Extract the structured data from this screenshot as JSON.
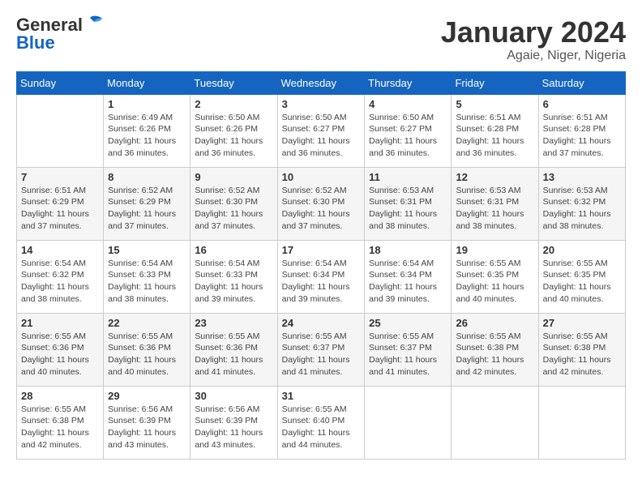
{
  "header": {
    "logo_general": "General",
    "logo_blue": "Blue",
    "month": "January 2024",
    "location": "Agaie, Niger, Nigeria"
  },
  "days_of_week": [
    "Sunday",
    "Monday",
    "Tuesday",
    "Wednesday",
    "Thursday",
    "Friday",
    "Saturday"
  ],
  "weeks": [
    [
      {
        "day": "",
        "sunrise": "",
        "sunset": "",
        "daylight": ""
      },
      {
        "day": "1",
        "sunrise": "Sunrise: 6:49 AM",
        "sunset": "Sunset: 6:26 PM",
        "daylight": "Daylight: 11 hours and 36 minutes."
      },
      {
        "day": "2",
        "sunrise": "Sunrise: 6:50 AM",
        "sunset": "Sunset: 6:26 PM",
        "daylight": "Daylight: 11 hours and 36 minutes."
      },
      {
        "day": "3",
        "sunrise": "Sunrise: 6:50 AM",
        "sunset": "Sunset: 6:27 PM",
        "daylight": "Daylight: 11 hours and 36 minutes."
      },
      {
        "day": "4",
        "sunrise": "Sunrise: 6:50 AM",
        "sunset": "Sunset: 6:27 PM",
        "daylight": "Daylight: 11 hours and 36 minutes."
      },
      {
        "day": "5",
        "sunrise": "Sunrise: 6:51 AM",
        "sunset": "Sunset: 6:28 PM",
        "daylight": "Daylight: 11 hours and 36 minutes."
      },
      {
        "day": "6",
        "sunrise": "Sunrise: 6:51 AM",
        "sunset": "Sunset: 6:28 PM",
        "daylight": "Daylight: 11 hours and 37 minutes."
      }
    ],
    [
      {
        "day": "7",
        "sunrise": "Sunrise: 6:51 AM",
        "sunset": "Sunset: 6:29 PM",
        "daylight": "Daylight: 11 hours and 37 minutes."
      },
      {
        "day": "8",
        "sunrise": "Sunrise: 6:52 AM",
        "sunset": "Sunset: 6:29 PM",
        "daylight": "Daylight: 11 hours and 37 minutes."
      },
      {
        "day": "9",
        "sunrise": "Sunrise: 6:52 AM",
        "sunset": "Sunset: 6:30 PM",
        "daylight": "Daylight: 11 hours and 37 minutes."
      },
      {
        "day": "10",
        "sunrise": "Sunrise: 6:52 AM",
        "sunset": "Sunset: 6:30 PM",
        "daylight": "Daylight: 11 hours and 37 minutes."
      },
      {
        "day": "11",
        "sunrise": "Sunrise: 6:53 AM",
        "sunset": "Sunset: 6:31 PM",
        "daylight": "Daylight: 11 hours and 38 minutes."
      },
      {
        "day": "12",
        "sunrise": "Sunrise: 6:53 AM",
        "sunset": "Sunset: 6:31 PM",
        "daylight": "Daylight: 11 hours and 38 minutes."
      },
      {
        "day": "13",
        "sunrise": "Sunrise: 6:53 AM",
        "sunset": "Sunset: 6:32 PM",
        "daylight": "Daylight: 11 hours and 38 minutes."
      }
    ],
    [
      {
        "day": "14",
        "sunrise": "Sunrise: 6:54 AM",
        "sunset": "Sunset: 6:32 PM",
        "daylight": "Daylight: 11 hours and 38 minutes."
      },
      {
        "day": "15",
        "sunrise": "Sunrise: 6:54 AM",
        "sunset": "Sunset: 6:33 PM",
        "daylight": "Daylight: 11 hours and 38 minutes."
      },
      {
        "day": "16",
        "sunrise": "Sunrise: 6:54 AM",
        "sunset": "Sunset: 6:33 PM",
        "daylight": "Daylight: 11 hours and 39 minutes."
      },
      {
        "day": "17",
        "sunrise": "Sunrise: 6:54 AM",
        "sunset": "Sunset: 6:34 PM",
        "daylight": "Daylight: 11 hours and 39 minutes."
      },
      {
        "day": "18",
        "sunrise": "Sunrise: 6:54 AM",
        "sunset": "Sunset: 6:34 PM",
        "daylight": "Daylight: 11 hours and 39 minutes."
      },
      {
        "day": "19",
        "sunrise": "Sunrise: 6:55 AM",
        "sunset": "Sunset: 6:35 PM",
        "daylight": "Daylight: 11 hours and 40 minutes."
      },
      {
        "day": "20",
        "sunrise": "Sunrise: 6:55 AM",
        "sunset": "Sunset: 6:35 PM",
        "daylight": "Daylight: 11 hours and 40 minutes."
      }
    ],
    [
      {
        "day": "21",
        "sunrise": "Sunrise: 6:55 AM",
        "sunset": "Sunset: 6:36 PM",
        "daylight": "Daylight: 11 hours and 40 minutes."
      },
      {
        "day": "22",
        "sunrise": "Sunrise: 6:55 AM",
        "sunset": "Sunset: 6:36 PM",
        "daylight": "Daylight: 11 hours and 40 minutes."
      },
      {
        "day": "23",
        "sunrise": "Sunrise: 6:55 AM",
        "sunset": "Sunset: 6:36 PM",
        "daylight": "Daylight: 11 hours and 41 minutes."
      },
      {
        "day": "24",
        "sunrise": "Sunrise: 6:55 AM",
        "sunset": "Sunset: 6:37 PM",
        "daylight": "Daylight: 11 hours and 41 minutes."
      },
      {
        "day": "25",
        "sunrise": "Sunrise: 6:55 AM",
        "sunset": "Sunset: 6:37 PM",
        "daylight": "Daylight: 11 hours and 41 minutes."
      },
      {
        "day": "26",
        "sunrise": "Sunrise: 6:55 AM",
        "sunset": "Sunset: 6:38 PM",
        "daylight": "Daylight: 11 hours and 42 minutes."
      },
      {
        "day": "27",
        "sunrise": "Sunrise: 6:55 AM",
        "sunset": "Sunset: 6:38 PM",
        "daylight": "Daylight: 11 hours and 42 minutes."
      }
    ],
    [
      {
        "day": "28",
        "sunrise": "Sunrise: 6:55 AM",
        "sunset": "Sunset: 6:38 PM",
        "daylight": "Daylight: 11 hours and 42 minutes."
      },
      {
        "day": "29",
        "sunrise": "Sunrise: 6:56 AM",
        "sunset": "Sunset: 6:39 PM",
        "daylight": "Daylight: 11 hours and 43 minutes."
      },
      {
        "day": "30",
        "sunrise": "Sunrise: 6:56 AM",
        "sunset": "Sunset: 6:39 PM",
        "daylight": "Daylight: 11 hours and 43 minutes."
      },
      {
        "day": "31",
        "sunrise": "Sunrise: 6:55 AM",
        "sunset": "Sunset: 6:40 PM",
        "daylight": "Daylight: 11 hours and 44 minutes."
      },
      {
        "day": "",
        "sunrise": "",
        "sunset": "",
        "daylight": ""
      },
      {
        "day": "",
        "sunrise": "",
        "sunset": "",
        "daylight": ""
      },
      {
        "day": "",
        "sunrise": "",
        "sunset": "",
        "daylight": ""
      }
    ]
  ]
}
